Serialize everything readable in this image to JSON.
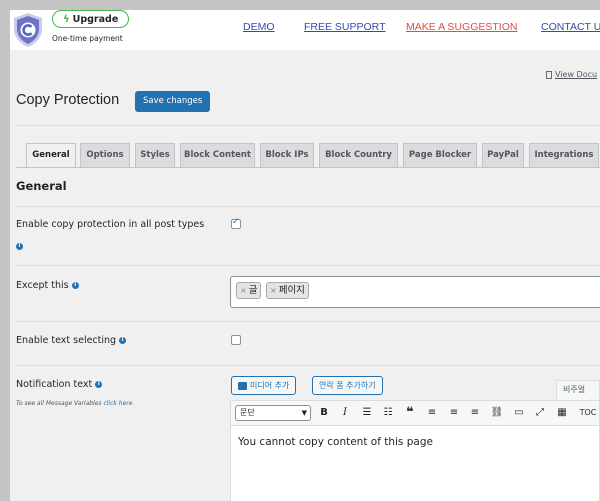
{
  "topbar": {
    "upgrade_label": "Upgrade",
    "one_time": "One-time payment",
    "nav": [
      "DEMO",
      "FREE SUPPORT",
      "MAKE A SUGGESTION",
      "CONTACT U"
    ]
  },
  "view_doc": "View Docu",
  "page": {
    "title": "Copy Protection",
    "save_label": "Save changes"
  },
  "tabs": [
    "General",
    "Options",
    "Styles",
    "Block Content",
    "Block IPs",
    "Block Country",
    "Page Blocker",
    "PayPal",
    "Integrations"
  ],
  "active_tab": "General",
  "section_title": "General",
  "settings": {
    "enable_copy_protection": {
      "label": "Enable copy protection in all post types",
      "checked": true
    },
    "except_this": {
      "label": "Except this",
      "chips": [
        "글",
        "페이지"
      ]
    },
    "enable_text_selecting": {
      "label": "Enable text selecting",
      "checked": false
    },
    "notification_text": {
      "label": "Notification text",
      "hint": "To see all Message Variables",
      "hint_link": "click here",
      "media_button": "미디어 추가",
      "contact_form_button": "연락 폼 추가하기",
      "visual_tab": "비주얼",
      "format_select": "문단",
      "toc_label": "TOC",
      "content": "You cannot copy content of this page"
    }
  },
  "colors": {
    "primary": "#2271b1",
    "upgrade_border": "#46b450",
    "suggestion": "#e14d43"
  }
}
